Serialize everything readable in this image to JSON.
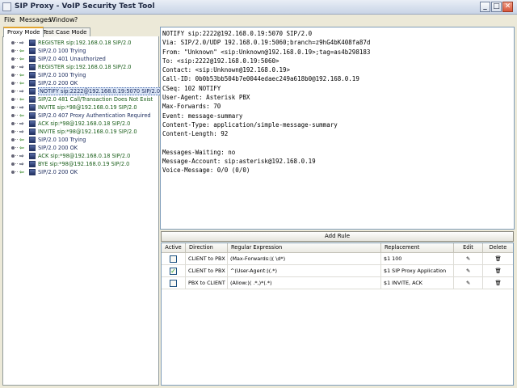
{
  "window": {
    "title": "SIP Proxy - VoIP Security Test Tool",
    "minimize": "_",
    "maximize": "□",
    "close": "✕"
  },
  "menubar": [
    {
      "label": "File"
    },
    {
      "label": "Messages"
    },
    {
      "label": "Window"
    },
    {
      "label": "?"
    }
  ],
  "tabs": [
    {
      "label": "Proxy Mode",
      "active": true
    },
    {
      "label": "Test Case Mode",
      "active": false
    }
  ],
  "tree": [
    {
      "label": "REGISTER sip:192.168.0.18 SIP/2.0",
      "direction": "out",
      "color": "green"
    },
    {
      "label": "SIP/2.0 100 Trying",
      "direction": "in",
      "color": "dark"
    },
    {
      "label": "SIP/2.0 401 Unauthorized",
      "direction": "in",
      "color": "dark"
    },
    {
      "label": "REGISTER sip:192.168.0.18 SIP/2.0",
      "direction": "out",
      "color": "green"
    },
    {
      "label": "SIP/2.0 100 Trying",
      "direction": "in",
      "color": "dark"
    },
    {
      "label": "SIP/2.0 200 OK",
      "direction": "in",
      "color": "dark"
    },
    {
      "label": "NOTIFY sip:2222@192.168.0.19:5070 SIP/2.0",
      "direction": "out",
      "color": "dark",
      "selected": true
    },
    {
      "label": "SIP/2.0 481 Call/Transaction Does Not Exist",
      "direction": "in",
      "color": "green"
    },
    {
      "label": "INVITE sip:*98@192.168.0.19 SIP/2.0",
      "direction": "out",
      "color": "green"
    },
    {
      "label": "SIP/2.0 407 Proxy Authentication Required",
      "direction": "in",
      "color": "dark"
    },
    {
      "label": "ACK sip:*98@192.168.0.18 SIP/2.0",
      "direction": "out",
      "color": "green"
    },
    {
      "label": "INVITE sip:*98@192.168.0.19 SIP/2.0",
      "direction": "out",
      "color": "green"
    },
    {
      "label": "SIP/2.0 100 Trying",
      "direction": "in",
      "color": "dark"
    },
    {
      "label": "SIP/2.0 200 OK",
      "direction": "in",
      "color": "dark"
    },
    {
      "label": "ACK sip:*98@192.168.0.18 SIP/2.0",
      "direction": "out",
      "color": "green"
    },
    {
      "label": "BYE sip:*98@192.168.0.19 SIP/2.0",
      "direction": "out",
      "color": "green"
    },
    {
      "label": "SIP/2.0 200 OK",
      "direction": "in",
      "color": "dark"
    }
  ],
  "message": {
    "lines": [
      "NOTIFY sip:2222@192.168.0.19:5070 SIP/2.0",
      "Via: SIP/2.0/UDP 192.168.0.19:5060;branch=z9hG4bK408fa87d",
      "From: \"Unknown\" <sip:Unknown@192.168.0.19>;tag=as4b298183",
      "To: <sip:2222@192.168.0.19:5060>",
      "Contact: <sip:Unknown@192.168.0.19>",
      "Call-ID: 0b0b53bb504b7e0044edaec249a618b0@192.168.0.19",
      "CSeq: 102 NOTIFY",
      "User-Agent: Asterisk PBX",
      "Max-Forwards: 70",
      "Event: message-summary",
      "Content-Type: application/simple-message-summary",
      "Content-Length: 92",
      "",
      "Messages-Waiting: no",
      "Message-Account: sip:asterisk@192.168.0.19",
      "Voice-Message: 0/0 (0/0)"
    ]
  },
  "rules": {
    "add_button": "Add Rule",
    "headers": [
      "Active",
      "Direction",
      "Regular Expression",
      "Replacement",
      "Edit",
      "Delete"
    ],
    "rows": [
      {
        "active": false,
        "direction": "CLIENT to PBX",
        "regex": "(Max-Forwards:)( \\d*)",
        "replacement": "$1 100"
      },
      {
        "active": true,
        "direction": "CLIENT to PBX",
        "regex": "^(User-Agent:)(.*)",
        "replacement": "$1 SIP Proxy Application"
      },
      {
        "active": false,
        "direction": "PBX to CLIENT",
        "regex": "(Allow:)( .*,)*(.*)",
        "replacement": "$1 INVITE, ACK"
      }
    ],
    "checkmark": "✓",
    "edit_glyph": "✎",
    "delete_glyph": "🗑"
  },
  "colors": {
    "titlebar": "#d6dfee",
    "tab_highlight": "#e1a531",
    "tree_green": "#1a5e1a",
    "tree_dark": "#1f2f60",
    "checkmark": "#21a121"
  }
}
